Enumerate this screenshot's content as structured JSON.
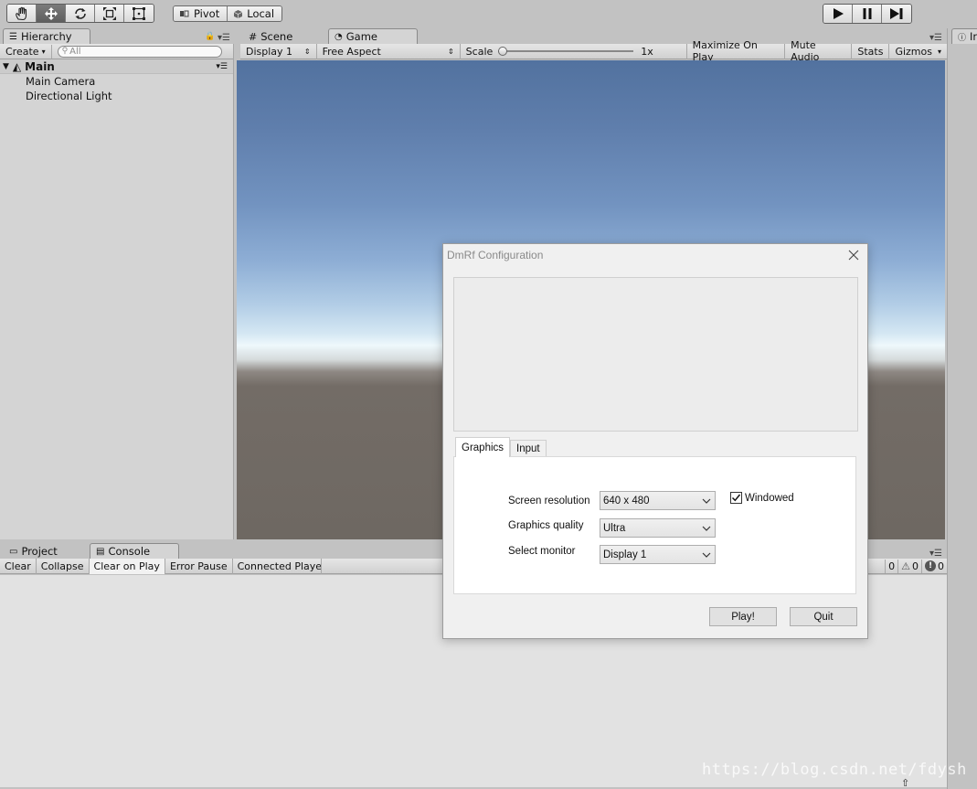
{
  "toolbar": {
    "tools": [
      {
        "icon": "hand-icon",
        "active": false
      },
      {
        "icon": "move-icon",
        "active": true
      },
      {
        "icon": "rotate-icon",
        "active": false
      },
      {
        "icon": "scale-icon",
        "active": false
      },
      {
        "icon": "rect-icon",
        "active": false
      }
    ],
    "pivot_label": "Pivot",
    "local_label": "Local"
  },
  "hierarchy": {
    "tab_label": "Hierarchy",
    "create_label": "Create",
    "search_placeholder": "All",
    "scene_name": "Main",
    "items": [
      "Main Camera",
      "Directional Light"
    ]
  },
  "scene_tabs": {
    "scene_label": "Scene",
    "game_label": "Game"
  },
  "game_bar": {
    "display": "Display 1",
    "aspect": "Free Aspect",
    "scale_label": "Scale",
    "scale_value": "1x",
    "maximize": "Maximize On Play",
    "mute": "Mute Audio",
    "stats": "Stats",
    "gizmos": "Gizmos"
  },
  "bottom_tabs": {
    "project_label": "Project",
    "console_label": "Console"
  },
  "console_bar": {
    "clear": "Clear",
    "collapse": "Collapse",
    "clear_on_play": "Clear on Play",
    "error_pause": "Error Pause",
    "connected_player": "Connected Playe",
    "log_count": "0",
    "warning_count": "0",
    "error_count": "0"
  },
  "inspector": {
    "tab_label": "In"
  },
  "dialog": {
    "title": "DmRf Configuration",
    "tabs": [
      "Graphics",
      "Input"
    ],
    "resolution_label": "Screen resolution",
    "resolution_value": "640 x 480",
    "quality_label": "Graphics quality",
    "quality_value": "Ultra",
    "monitor_label": "Select monitor",
    "monitor_value": "Display 1",
    "windowed_label": "Windowed",
    "windowed_checked": true,
    "play_label": "Play!",
    "quit_label": "Quit"
  },
  "watermark": "https://blog.csdn.net/fdysh"
}
